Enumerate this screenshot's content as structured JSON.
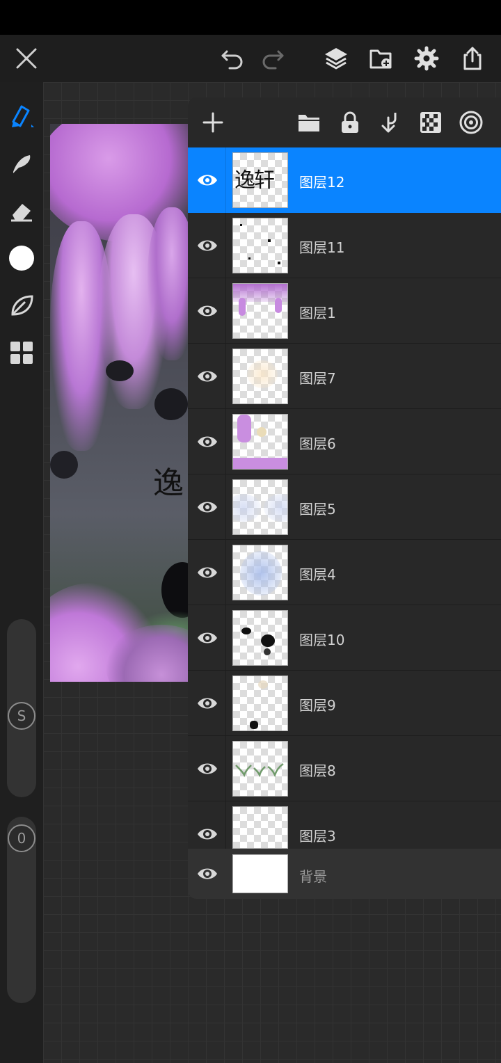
{
  "toolbar": {
    "close_icon": "close-icon",
    "undo_icon": "undo-icon",
    "redo_icon": "redo-icon",
    "layers_icon": "layers-icon",
    "import_icon": "import-icon",
    "settings_icon": "gear-icon",
    "share_icon": "share-icon"
  },
  "tools": [
    "brush-icon",
    "smudge-icon",
    "eraser-icon",
    "color-icon",
    "leaf-icon",
    "grid-icon"
  ],
  "sliders": {
    "size_label": "S",
    "opacity_label": "0"
  },
  "colors": {
    "accent": "#0a84ff",
    "panel": "#282828",
    "selected_row": "#0a84ff"
  },
  "layers_panel": {
    "header_icons": [
      "add-icon",
      "folder-icon",
      "lock-icon",
      "merge-down-icon",
      "transparency-icon",
      "target-icon"
    ],
    "layers": [
      {
        "name": "图层12",
        "selected": true,
        "thumb_text": "逸轩"
      },
      {
        "name": "图层11",
        "selected": false
      },
      {
        "name": "图层1",
        "selected": false
      },
      {
        "name": "图层7",
        "selected": false
      },
      {
        "name": "图层6",
        "selected": false
      },
      {
        "name": "图层5",
        "selected": false
      },
      {
        "name": "图层4",
        "selected": false
      },
      {
        "name": "图层10",
        "selected": false
      },
      {
        "name": "图层9",
        "selected": false
      },
      {
        "name": "图层8",
        "selected": false
      },
      {
        "name": "图层3",
        "selected": false
      }
    ],
    "background_layer": {
      "name": "背景"
    }
  },
  "canvas": {
    "art_text": "逸"
  }
}
